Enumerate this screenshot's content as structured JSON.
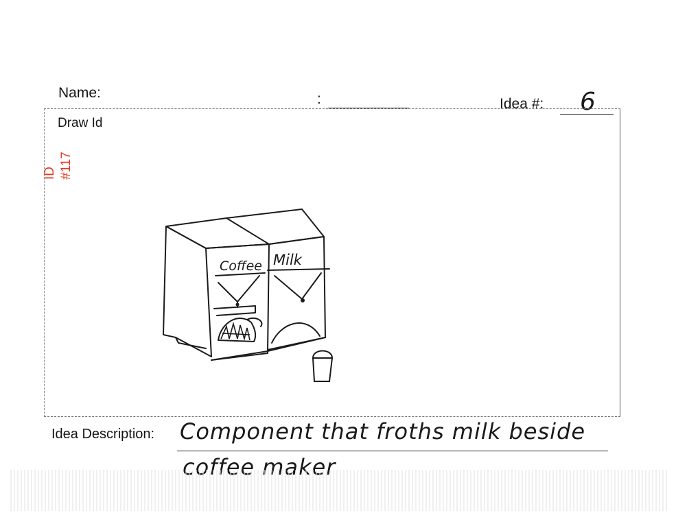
{
  "form": {
    "name_label": "Name:",
    "colon_label": ":",
    "idea_number_label": "Idea #:",
    "idea_number_value": "6",
    "draw_label": "Draw Idea Here:",
    "description_label": "Idea Description:"
  },
  "stamp": {
    "id_label": "ID",
    "id_value": "#117",
    "color": "#e23a24"
  },
  "sketch": {
    "left_label": "Coffee",
    "right_label": "Milk"
  },
  "description": {
    "line1": "Component that froths milk beside",
    "line2": "coffee maker"
  }
}
